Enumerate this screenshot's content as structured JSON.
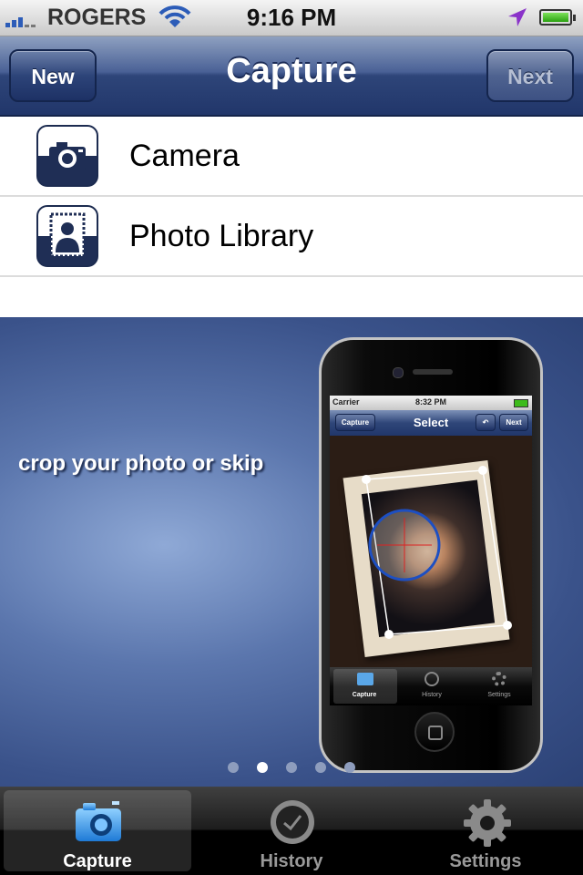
{
  "status_bar": {
    "carrier": "ROGERS",
    "time": "9:16 PM"
  },
  "nav": {
    "title": "Capture",
    "left_button": "New",
    "right_button": "Next"
  },
  "list": [
    {
      "label": "Camera",
      "icon": "camera-icon"
    },
    {
      "label": "Photo Library",
      "icon": "photo-library-icon"
    }
  ],
  "banner": {
    "caption": "crop your photo or skip",
    "page_count": 5,
    "current_page": 2,
    "phone": {
      "status": {
        "carrier": "Carrier",
        "time": "8:32 PM"
      },
      "nav": {
        "title": "Select",
        "left": "Capture",
        "right": "Next"
      },
      "tabs": [
        "Capture",
        "History",
        "Settings"
      ]
    }
  },
  "tabbar": [
    {
      "label": "Capture",
      "icon": "camera-icon",
      "selected": true
    },
    {
      "label": "History",
      "icon": "clock-icon",
      "selected": false
    },
    {
      "label": "Settings",
      "icon": "gear-icon",
      "selected": false
    }
  ]
}
